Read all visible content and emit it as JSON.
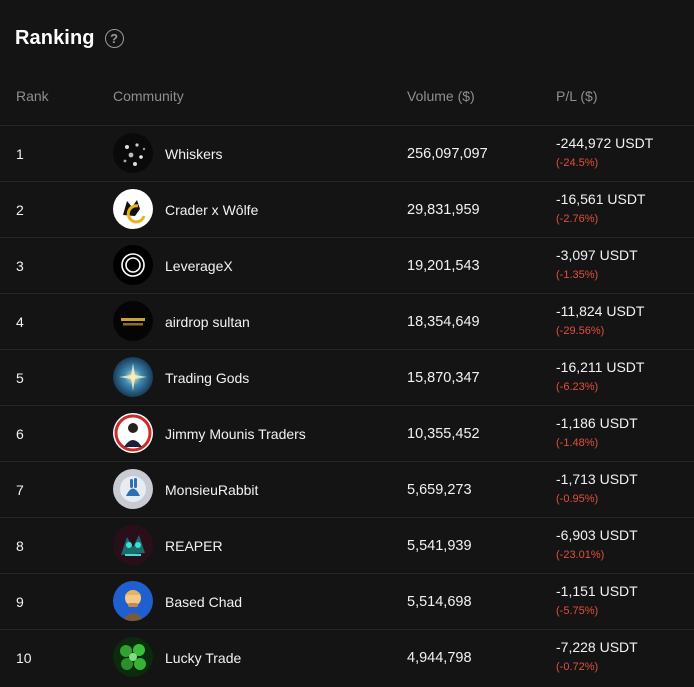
{
  "header": {
    "title": "Ranking",
    "help_icon": "question-circle-icon"
  },
  "columns": {
    "rank": "Rank",
    "community": "Community",
    "volume": "Volume ($)",
    "pl": "P/L ($)"
  },
  "colors": {
    "background": "#141414",
    "loss": "#e0503d",
    "muted": "#8e8e8e"
  },
  "rows": [
    {
      "rank": "1",
      "name": "Whiskers",
      "volume": "256,097,097",
      "pl": "-244,972 USDT",
      "pct": "(-24.5%)"
    },
    {
      "rank": "2",
      "name": "Crader x Wôlfe",
      "volume": "29,831,959",
      "pl": "-16,561 USDT",
      "pct": "(-2.76%)"
    },
    {
      "rank": "3",
      "name": "LeverageX",
      "volume": "19,201,543",
      "pl": "-3,097 USDT",
      "pct": "(-1.35%)"
    },
    {
      "rank": "4",
      "name": "airdrop sultan",
      "volume": "18,354,649",
      "pl": "-11,824 USDT",
      "pct": "(-29.56%)"
    },
    {
      "rank": "5",
      "name": "Trading Gods",
      "volume": "15,870,347",
      "pl": "-16,211 USDT",
      "pct": "(-6.23%)"
    },
    {
      "rank": "6",
      "name": "Jimmy Mounis Traders",
      "volume": "10,355,452",
      "pl": "-1,186 USDT",
      "pct": "(-1.48%)"
    },
    {
      "rank": "7",
      "name": "MonsieuRabbit",
      "volume": "5,659,273",
      "pl": "-1,713 USDT",
      "pct": "(-0.95%)"
    },
    {
      "rank": "8",
      "name": "REAPER",
      "volume": "5,541,939",
      "pl": "-6,903 USDT",
      "pct": "(-23.01%)"
    },
    {
      "rank": "9",
      "name": "Based Chad",
      "volume": "5,514,698",
      "pl": "-1,151 USDT",
      "pct": "(-5.75%)"
    },
    {
      "rank": "10",
      "name": "Lucky Trade",
      "volume": "4,944,798",
      "pl": "-7,228 USDT",
      "pct": "(-0.72%)"
    }
  ]
}
